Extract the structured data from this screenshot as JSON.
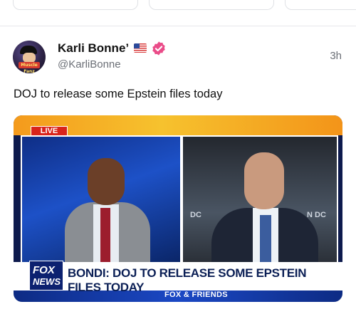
{
  "post": {
    "author_name": "Karli Bonne’",
    "handle": "@KarliBonne",
    "time": "3h",
    "text": "DOJ to release some Epstein files today"
  },
  "avatar": {
    "badge_text": "Muscle Fanz"
  },
  "media": {
    "live_label": "LIVE",
    "headline": "BONDI: DOJ TO RELEASE SOME EPSTEIN FILES TODAY",
    "network_top": "FOX",
    "network_bottom": "NEWS",
    "show_name": "FOX & FRIENDS",
    "bg_label_1": "DC",
    "bg_label_2": "N DC"
  },
  "icons": {
    "flag": "us-flag-icon",
    "verified": "verified-badge-icon"
  },
  "colors": {
    "verified": "#ea4c89",
    "live": "#d9241b",
    "fox_blue": "#0c2170"
  }
}
